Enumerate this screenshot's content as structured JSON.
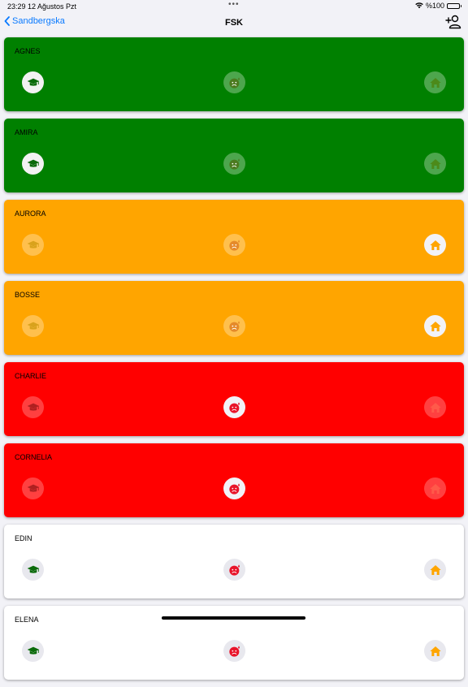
{
  "status": {
    "time": "23:29",
    "date": "12 Ağustos Pzt",
    "battery": "%100",
    "dots": "•••"
  },
  "nav": {
    "back_label": "Sandbergska",
    "title": "FSK"
  },
  "colors": {
    "green": "#008000",
    "orange": "#ffa500",
    "red": "#ff0000",
    "white": "#ffffff"
  },
  "students": [
    {
      "name": "AGNES",
      "status": "green",
      "icons": [
        "graduation-cap-icon",
        "sad-face-icon",
        "home-icon"
      ]
    },
    {
      "name": "AMIRA",
      "status": "green",
      "icons": [
        "graduation-cap-icon",
        "sad-face-icon",
        "home-icon"
      ]
    },
    {
      "name": "AURORA",
      "status": "orange",
      "icons": [
        "graduation-cap-icon",
        "sad-face-icon",
        "home-icon"
      ]
    },
    {
      "name": "BOSSE",
      "status": "orange",
      "icons": [
        "graduation-cap-icon",
        "sad-face-icon",
        "home-icon"
      ]
    },
    {
      "name": "CHARLIE",
      "status": "red",
      "icons": [
        "graduation-cap-icon",
        "sad-face-icon",
        "home-icon"
      ]
    },
    {
      "name": "CORNELIA",
      "status": "red",
      "icons": [
        "graduation-cap-icon",
        "sad-face-icon",
        "home-icon"
      ]
    },
    {
      "name": "EDIN",
      "status": "white",
      "icons": [
        "graduation-cap-icon",
        "sad-face-icon",
        "home-icon"
      ]
    },
    {
      "name": "ELENA",
      "status": "white",
      "icons": [
        "graduation-cap-icon",
        "sad-face-icon",
        "home-icon"
      ]
    }
  ]
}
